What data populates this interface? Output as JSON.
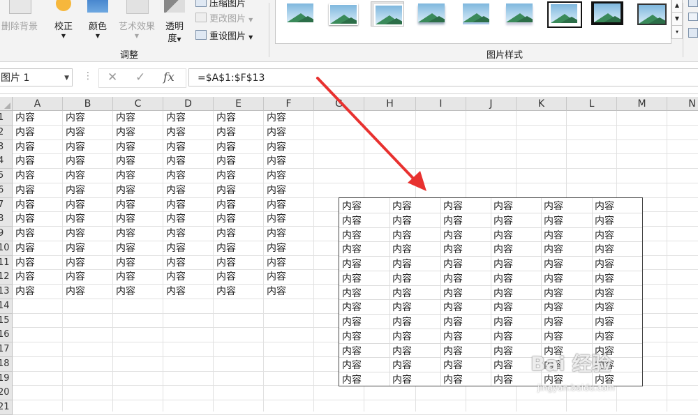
{
  "ribbon": {
    "remove_background": "删除背景",
    "corrections": "校正",
    "color": "颜色",
    "artistic_effects": "艺术效果",
    "transparency_line1": "透明",
    "transparency_line2": "度",
    "compress_pictures": "压缩图片",
    "change_picture": "更改图片",
    "reset_picture": "重设图片",
    "group_adjust": "调整",
    "group_picture_styles": "图片样式"
  },
  "formula_bar": {
    "name_box": "图片 1",
    "cancel_glyph": "✕",
    "enter_glyph": "✓",
    "fx_glyph": "fx",
    "formula": "=$A$1:$F$13"
  },
  "sheet": {
    "columns": [
      "A",
      "B",
      "C",
      "D",
      "E",
      "F",
      "G",
      "H",
      "I",
      "J",
      "K",
      "L",
      "M",
      "N"
    ],
    "rows": [
      "1",
      "2",
      "3",
      "4",
      "5",
      "6",
      "7",
      "8",
      "9",
      "10",
      "11",
      "12",
      "13",
      "14",
      "15",
      "16",
      "17",
      "18",
      "19",
      "20",
      "21"
    ],
    "cell_value": "内容",
    "filled_rows": 13,
    "filled_cols": 6
  },
  "picture": {
    "rows": 13,
    "cols": 6,
    "cell_value": "内容"
  },
  "watermark": {
    "main": "Bai 经验",
    "sub": "jingyan.baidu.com"
  },
  "colors": {
    "arrow": "#e8312f",
    "ribbon_bg": "#f3f3f3",
    "header_bg": "#e6e6e6"
  }
}
